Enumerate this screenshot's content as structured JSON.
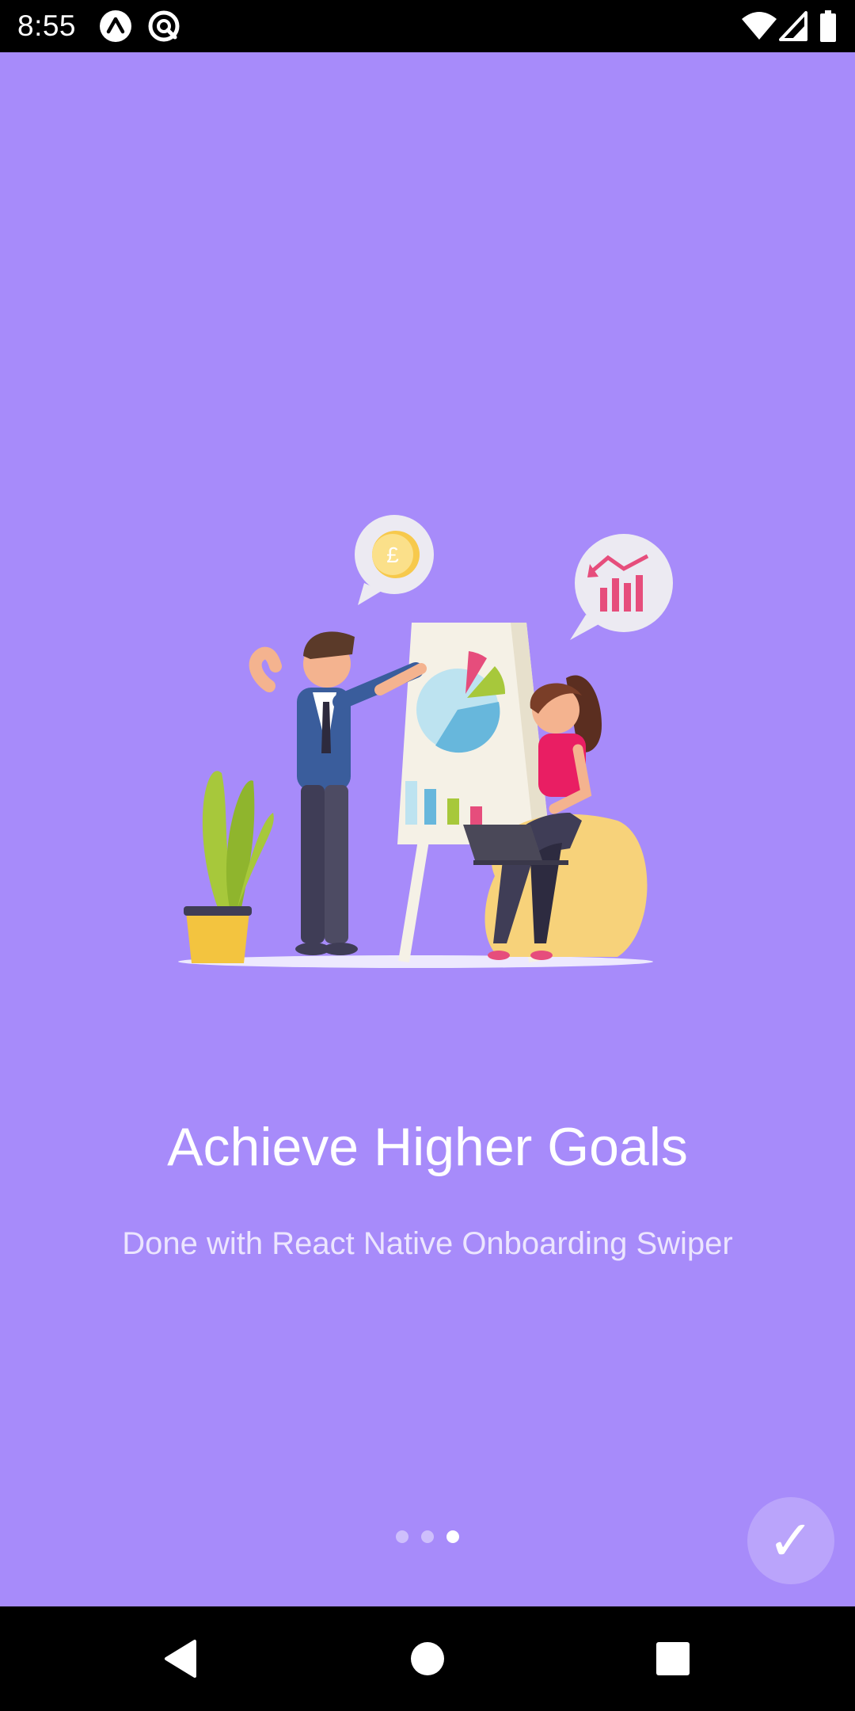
{
  "status_bar": {
    "time": "8:55",
    "icons": [
      "app-notification-icon",
      "sync-notification-icon",
      "wifi-icon",
      "cell-signal-icon",
      "battery-icon"
    ]
  },
  "slide": {
    "background_color": "#a78bfa",
    "illustration_icon": "business-presentation-illustration",
    "title": "Achieve Higher Goals",
    "subtitle": "Done with React Native Onboarding Swiper"
  },
  "pagination": {
    "total": 3,
    "active_index": 2
  },
  "done_button": {
    "label": "✓"
  },
  "nav_bar": {
    "buttons": [
      "back-icon",
      "home-icon",
      "recents-icon"
    ]
  }
}
